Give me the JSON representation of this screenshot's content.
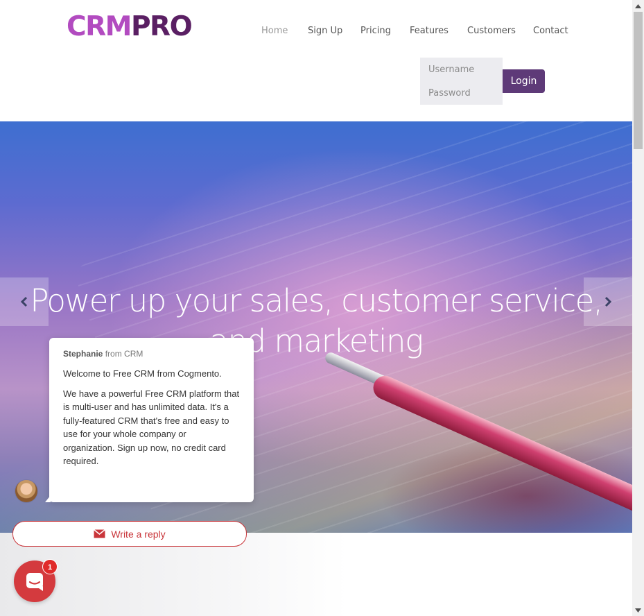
{
  "brand": {
    "logo_part1": "CRM",
    "logo_part2": "PRO",
    "color_primary": "#b24bc0",
    "color_secondary": "#5a1f63"
  },
  "nav": {
    "items": [
      {
        "label": "Home",
        "active": true
      },
      {
        "label": "Sign Up"
      },
      {
        "label": "Pricing"
      },
      {
        "label": "Features"
      },
      {
        "label": "Customers"
      },
      {
        "label": "Contact"
      }
    ]
  },
  "login": {
    "username_placeholder": "Username",
    "password_placeholder": "Password",
    "button_label": "Login",
    "button_color": "#5e3a78"
  },
  "hero": {
    "title_line1": "Power up your sales, customer service,",
    "title_line2": "and marketing",
    "prev_icon": "chevron-left-icon",
    "next_icon": "chevron-right-icon"
  },
  "chat": {
    "sender_name": "Stephanie",
    "sender_suffix": "from CRM",
    "message_1": "Welcome to Free CRM from Cogmento.",
    "message_2": "We have a powerful Free CRM platform that is multi-user and has unlimited data.  It's a fully-featured CRM that's free and easy to use for your whole company or organization.  Sign up now, no credit card required.",
    "reply_label": "Write a reply",
    "reply_icon": "envelope-icon",
    "launcher_icon": "chat-icon",
    "unread_count": "1",
    "accent_color": "#d43a3e"
  }
}
